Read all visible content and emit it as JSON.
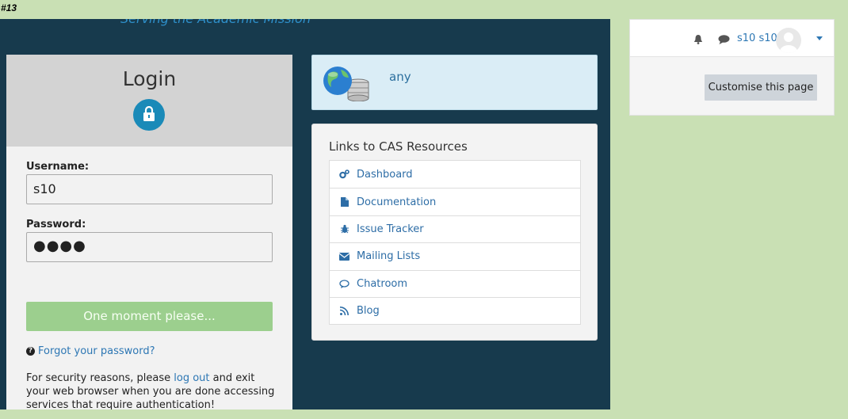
{
  "tag": "#13",
  "banner": {
    "text": "Serving the Academic Mission"
  },
  "login": {
    "title": "Login",
    "lock_icon": "lock-icon",
    "username_label": "Username:",
    "username_value": "s10",
    "password_label": "Password:",
    "password_value": "●●●●",
    "submit_label": "One moment please...",
    "forgot_label": "Forgot your password?",
    "security": {
      "prefix": "For security reasons, please ",
      "link": "log out",
      "suffix": " and exit your web browser when you are done accessing services that require authentication!"
    }
  },
  "info": {
    "text": "any",
    "icon": "globe-database-icon"
  },
  "links": {
    "title": "Links to CAS Resources",
    "items": [
      {
        "label": "Dashboard",
        "icon": "cogs-icon"
      },
      {
        "label": "Documentation",
        "icon": "file-icon"
      },
      {
        "label": "Issue Tracker",
        "icon": "bug-icon"
      },
      {
        "label": "Mailing Lists",
        "icon": "envelope-icon"
      },
      {
        "label": "Chatroom",
        "icon": "comment-icon"
      },
      {
        "label": "Blog",
        "icon": "rss-icon"
      }
    ]
  },
  "user_menu": {
    "username": "s10 s10",
    "customise_label": "Customise this page"
  },
  "colors": {
    "background": "#c9e0b4",
    "cas_bg": "#173a4d",
    "accent": "#1a8ab8",
    "link": "#2d77b4",
    "submit": "#9ccf8e"
  }
}
